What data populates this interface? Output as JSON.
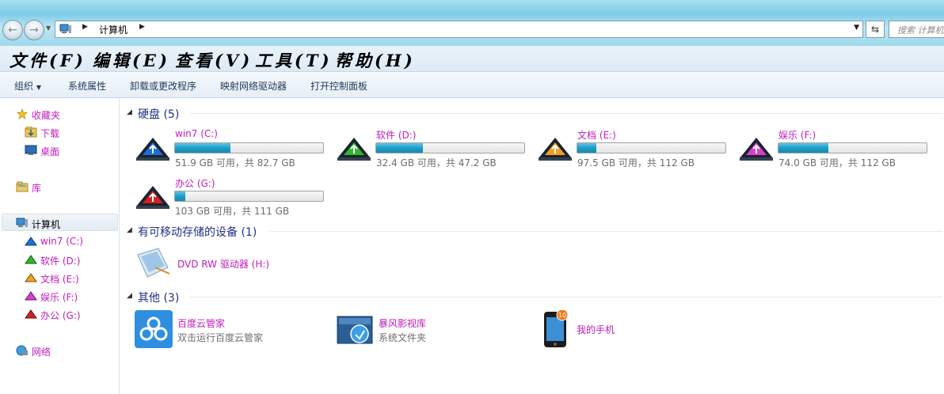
{
  "address": {
    "crumb": "计算机",
    "search_placeholder": "搜索 计算机"
  },
  "menu": [
    "文件(F)",
    "编辑(E)",
    "查看(V)",
    "工具(T)",
    "帮助(H)"
  ],
  "toolbar": {
    "organize": "组织",
    "system_properties": "系统属性",
    "uninstall": "卸载或更改程序",
    "map_drive": "映射网络驱动器",
    "control_panel": "打开控制面板"
  },
  "sidebar": {
    "favorites": "收藏夹",
    "downloads": "下载",
    "desktop": "桌面",
    "libraries": "库",
    "computer": "计算机",
    "drives": [
      "win7 (C:)",
      "软件 (D:)",
      "文档 (E:)",
      "娱乐 (F:)",
      "办公 (G:)"
    ],
    "network": "网络"
  },
  "groups": {
    "hard_disks": "硬盘 (5)",
    "removable": "有可移动存储的设备 (1)",
    "other": "其他 (3)"
  },
  "drives": [
    {
      "name": "win7 (C:)",
      "free": "51.9 GB 可用，共 82.7 GB",
      "used_fraction": 0.372,
      "color": "#1a6fd6"
    },
    {
      "name": "软件 (D:)",
      "free": "32.4 GB 可用，共 47.2 GB",
      "used_fraction": 0.314,
      "color": "#2fb52f"
    },
    {
      "name": "文档 (E:)",
      "free": "97.5 GB 可用，共 112 GB",
      "used_fraction": 0.129,
      "color": "#f0a020"
    },
    {
      "name": "娱乐 (F:)",
      "free": "74.0 GB 可用，共 112 GB",
      "used_fraction": 0.339,
      "color": "#d640c8"
    },
    {
      "name": "办公 (G:)",
      "free": "103 GB 可用，共 111 GB",
      "used_fraction": 0.072,
      "color": "#d42020"
    }
  ],
  "dvd": {
    "name": "DVD RW 驱动器 (H:)"
  },
  "others": [
    {
      "name": "百度云管家",
      "sub": "双击运行百度云管家"
    },
    {
      "name": "暴风影视库",
      "sub": "系统文件夹"
    },
    {
      "name": "我的手机",
      "sub": "",
      "badge": "10"
    }
  ],
  "colors": {
    "link": "#c21cbf",
    "accent": "#1e3287",
    "bar": "#1f9cc6"
  }
}
